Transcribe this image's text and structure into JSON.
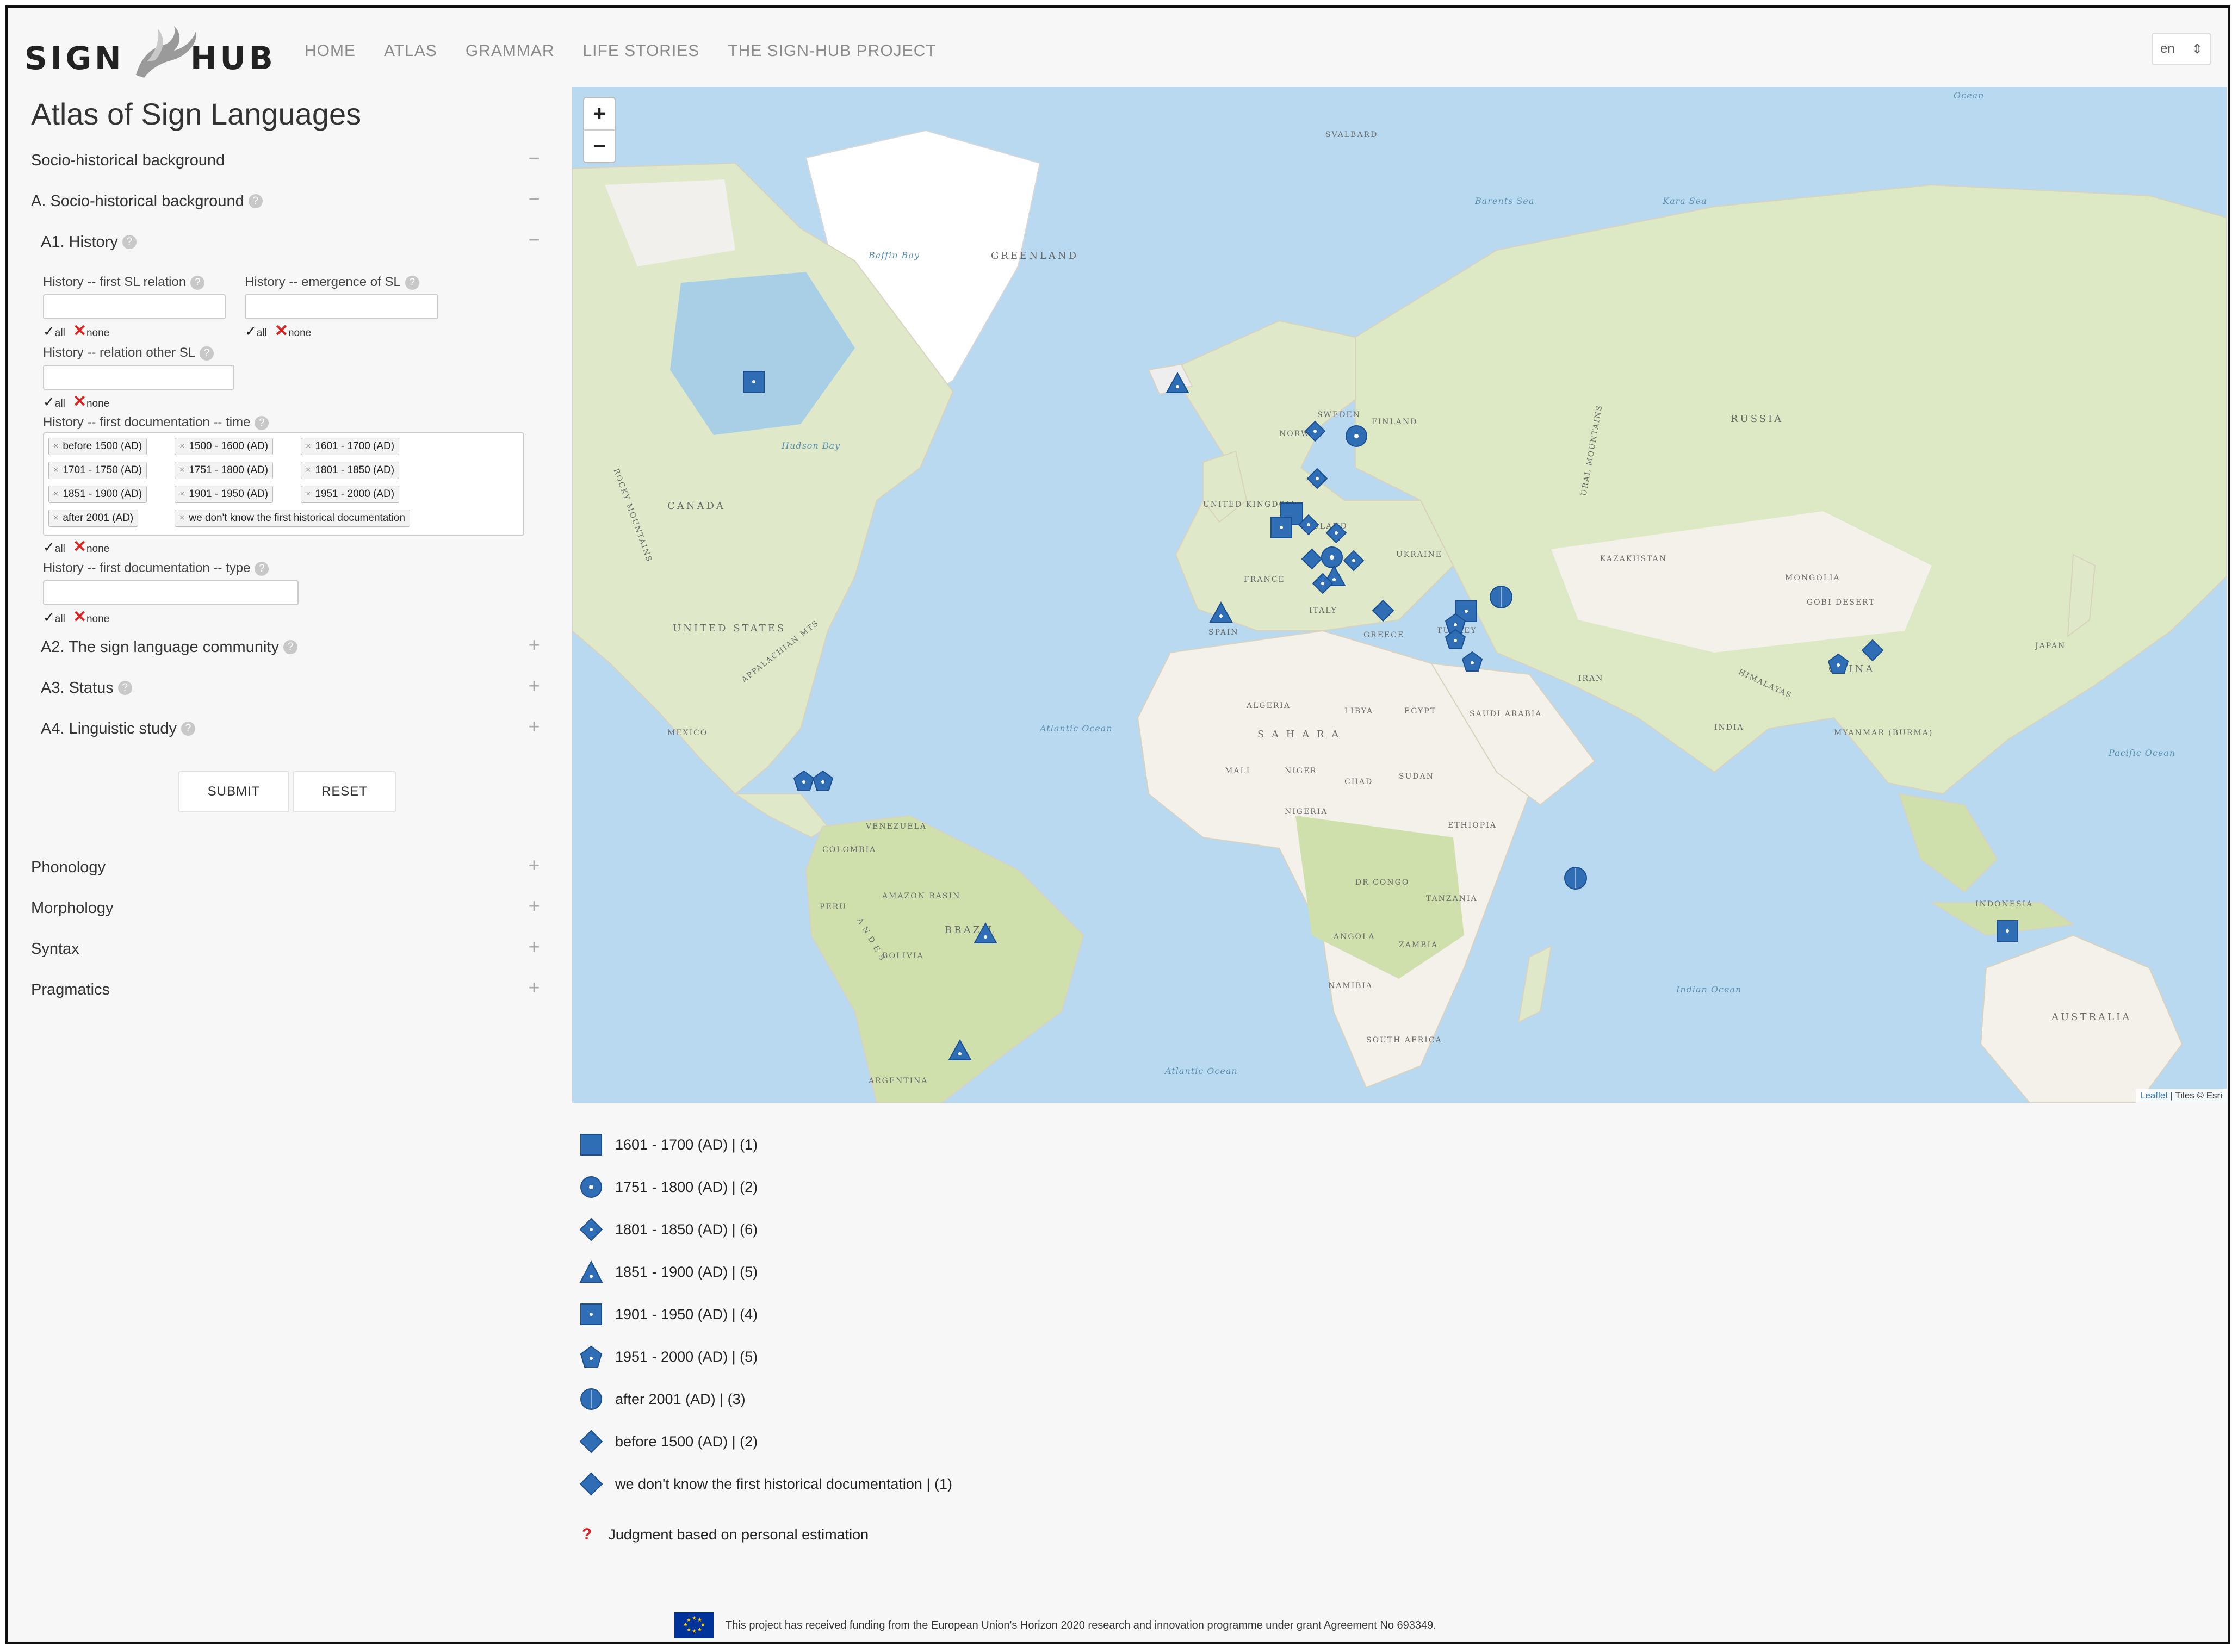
{
  "header": {
    "logo_left": "SIGN",
    "logo_right": "HUB",
    "nav": [
      "HOME",
      "ATLAS",
      "GRAMMAR",
      "LIFE STORIES",
      "THE SIGN-HUB PROJECT"
    ],
    "language": "en",
    "language_arrow": "⇕"
  },
  "sidebar": {
    "title": "Atlas of Sign Languages",
    "sections": [
      {
        "label": "Socio-historical background",
        "toggle": "−"
      },
      {
        "label": "A. Socio-historical background",
        "toggle": "−"
      },
      {
        "label": "A1. History",
        "toggle": "−"
      },
      {
        "label": "A2. The sign language community",
        "toggle": "+"
      },
      {
        "label": "A3. Status",
        "toggle": "+"
      },
      {
        "label": "A4. Linguistic study",
        "toggle": "+"
      },
      {
        "label": "Phonology",
        "toggle": "+"
      },
      {
        "label": "Morphology",
        "toggle": "+"
      },
      {
        "label": "Syntax",
        "toggle": "+"
      },
      {
        "label": "Pragmatics",
        "toggle": "+"
      }
    ],
    "help_glyph": "?",
    "fields": {
      "first_sl_relation": "History -- first SL relation",
      "emergence_of_sl": "History -- emergence of SL",
      "relation_other_sl": "History -- relation other SL",
      "first_doc_time": "History -- first documentation -- time",
      "first_doc_type": "History -- first documentation -- type"
    },
    "all_label": "all",
    "none_label": "none",
    "check_glyph": "✓",
    "cross_glyph": "✕",
    "tag_remove": "×",
    "time_tags": [
      "before 1500 (AD)",
      "1500 - 1600 (AD)",
      "1601 - 1700 (AD)",
      "1701 - 1750 (AD)",
      "1751 - 1800 (AD)",
      "1801 - 1850 (AD)",
      "1851 - 1900 (AD)",
      "1901 - 1950 (AD)",
      "1951 - 2000 (AD)",
      "after 2001 (AD)",
      "we don't know the first historical documentation"
    ],
    "submit_label": "SUBMIT",
    "reset_label": "RESET"
  },
  "map": {
    "zoom_in": "+",
    "zoom_out": "−",
    "labels": {
      "greenland": "GREENLAND",
      "canada": "CANADA",
      "united_states": "UNITED STATES",
      "mexico": "MEXICO",
      "venezuela": "VENEZUELA",
      "colombia": "COLOMBIA",
      "peru": "PERU",
      "brazil": "BRAZIL",
      "bolivia": "BOLIVIA",
      "argentina": "ARGENTINA",
      "amazon_basin": "AMAZON BASIN",
      "andes": "A N D E S",
      "russia": "RUSSIA",
      "finland": "FINLAND",
      "sweden": "SWEDEN",
      "norway": "NORWAY",
      "united_kingdom": "UNITED KINGDOM",
      "france": "FRANCE",
      "spain": "SPAIN",
      "italy": "ITALY",
      "poland": "POLAND",
      "ukraine": "UKRAINE",
      "greece": "GREECE",
      "turkey": "TURKEY",
      "kazakhstan": "KAZAKHSTAN",
      "mongolia": "MONGOLIA",
      "gobi_desert": "GOBI DESERT",
      "china": "CHINA",
      "japan": "JAPAN",
      "iran": "IRAN",
      "india": "INDIA",
      "himalayas": "HIMALAYAS",
      "myanmar": "MYANMAR (BURMA)",
      "indonesia": "INDONESIA",
      "australia": "AUSTRALIA",
      "algeria": "ALGERIA",
      "libya": "LIBYA",
      "egypt": "EGYPT",
      "sahara": "S A H A R A",
      "saudi_arabia": "SAUDI ARABIA",
      "mali": "MALI",
      "niger": "NIGER",
      "chad": "CHAD",
      "sudan": "SUDAN",
      "nigeria": "NIGERIA",
      "ethiopia": "ETHIOPIA",
      "dr_congo": "DR CONGO",
      "tanzania": "TANZANIA",
      "angola": "ANGOLA",
      "zambia": "ZAMBIA",
      "namibia": "NAMIBIA",
      "south_africa": "SOUTH AFRICA",
      "atlantic_ocean": "Atlantic Ocean",
      "atlantic_ocean_s": "Atlantic Ocean",
      "indian_ocean": "Indian Ocean",
      "pacific_ocean": "Pacific Ocean",
      "ocean_top": "Ocean",
      "svalbard": "SVALBARD",
      "rocky_mountains": "ROCKY MOUNTAINS",
      "appalachian": "APPALACHIAN MTS",
      "ural": "URAL MOUNTAINS",
      "hudson_bay": "Hudson Bay",
      "baffin_bay": "Baffin Bay",
      "kara_sea": "Kara Sea",
      "barents_sea": "Barents Sea"
    },
    "attribution_leaflet": "Leaflet",
    "attribution_tiles": "| Tiles © Esri",
    "colors": {
      "water": "#b8d9ef",
      "land": "#f3f1ea",
      "vegetation": "#d6e7bf",
      "ice": "#ffffff",
      "marker": "#2f6db5"
    }
  },
  "legend": {
    "items": [
      {
        "shape": "square",
        "label": "1601 - 1700 (AD) | (1)"
      },
      {
        "shape": "circle",
        "label": "1751 - 1800 (AD) | (2)"
      },
      {
        "shape": "diamond-dot",
        "label": "1801 - 1850 (AD) | (6)"
      },
      {
        "shape": "triangle",
        "label": "1851 - 1900 (AD) | (5)"
      },
      {
        "shape": "square-dot",
        "label": "1901 - 1950 (AD) | (4)"
      },
      {
        "shape": "pentagon",
        "label": "1951 - 2000 (AD) | (5)"
      },
      {
        "shape": "circle-line",
        "label": "after 2001 (AD) | (3)"
      },
      {
        "shape": "diamond",
        "label": "before 1500 (AD) | (2)"
      },
      {
        "shape": "diamond",
        "label": "we don't know the first historical documentation | (1)"
      }
    ],
    "note_symbol": "?",
    "note": "Judgment based on personal estimation"
  },
  "footer": {
    "text": "This project has received funding from the European Union's Horizon 2020 research and innovation programme under grant Agreement No 693349."
  }
}
